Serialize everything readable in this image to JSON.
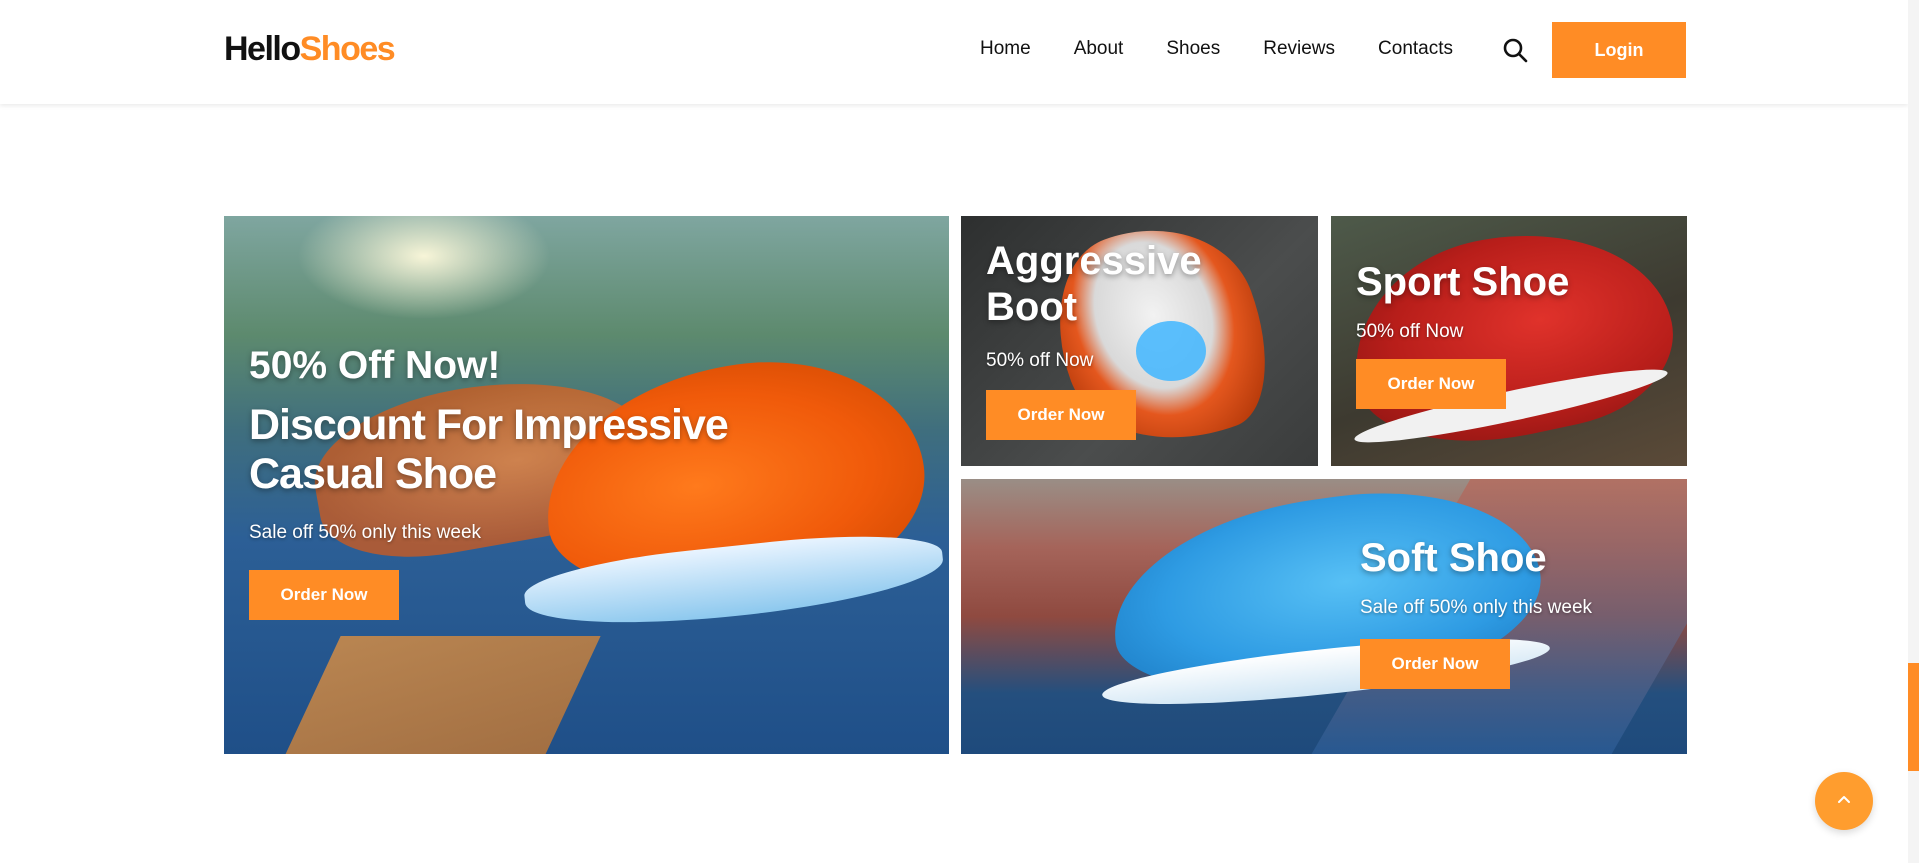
{
  "header": {
    "logo_primary": "Hello",
    "logo_accent": "Shoes",
    "nav": [
      "Home",
      "About",
      "Shoes",
      "Reviews",
      "Contacts"
    ],
    "search_icon": "search-icon",
    "login_label": "Login"
  },
  "colors": {
    "accent": "#ff8c25",
    "text": "#111111",
    "background": "#ffffff"
  },
  "cards": {
    "main": {
      "kicker": "50% Off Now!",
      "title": "Discount For Impressive Casual Shoe",
      "subtitle": "Sale off 50% only this week",
      "button": "Order Now"
    },
    "boot": {
      "title": "Aggressive Boot",
      "subtitle": "50% off Now",
      "button": "Order Now"
    },
    "sport": {
      "title": "Sport Shoe",
      "subtitle": "50% off Now",
      "button": "Order Now"
    },
    "soft": {
      "title": "Soft Shoe",
      "subtitle": "Sale off 50% only this week",
      "button": "Order Now"
    }
  },
  "back_to_top_icon": "chevron-up-icon"
}
